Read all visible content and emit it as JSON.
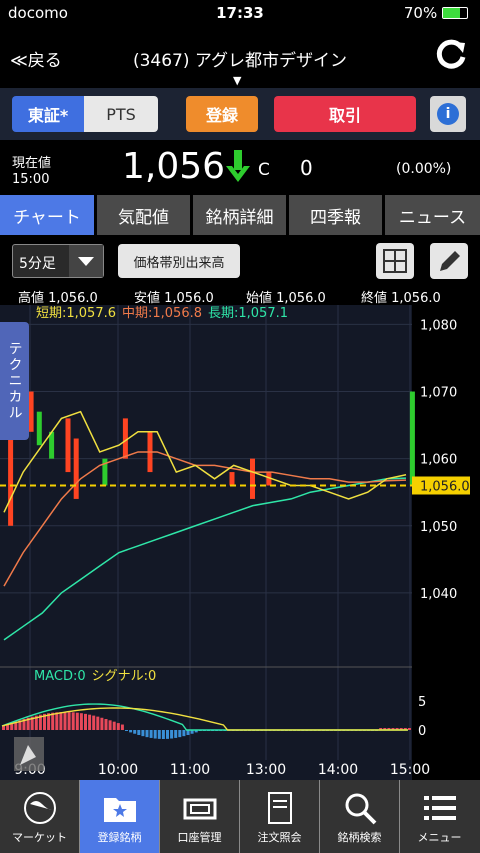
{
  "status": {
    "carrier": "docomo",
    "time": "17:33",
    "battery": "70%"
  },
  "nav": {
    "back": "≪戻る",
    "title": "(3467) アグレ都市デザイン",
    "caret": "▼"
  },
  "buttons": {
    "tse": "東証*",
    "pts": "PTS",
    "register": "登録",
    "trade": "取引",
    "info": "i"
  },
  "price": {
    "label": "現在値",
    "time": "15:00",
    "value": "1,056",
    "flag": "C",
    "change": "0",
    "pct": "(0.00%)"
  },
  "tabs": [
    "チャート",
    "気配値",
    "銘柄詳細",
    "四季報",
    "ニュース"
  ],
  "tools": {
    "interval": "5分足",
    "volume_by_price": "価格帯別出来高"
  },
  "ohlc": {
    "high": "高値 1,056.0",
    "low": "安値 1,056.0",
    "open": "始値 1,056.0",
    "close": "終値 1,056.0"
  },
  "technical_tab": "テクニカル",
  "ma_legend": {
    "short": "短期:1,057.6",
    "mid": "中期:1,056.8",
    "long": "長期:1,057.1"
  },
  "price_axis": [
    "1,080",
    "1,070",
    "1,060",
    "1,050",
    "1,040"
  ],
  "current_price_label": "1,056.0",
  "macd_legend": {
    "macd": "MACD:0",
    "signal": "シグナル:0"
  },
  "macd_axis": [
    "5",
    "0"
  ],
  "time_axis": [
    "9:00",
    "10:00",
    "11:00",
    "13:00",
    "14:00",
    "15:00"
  ],
  "colors": {
    "accent": "#4d79e6",
    "up": "#2ecc2e",
    "down": "#ff4422",
    "short_ma": "#f0e040",
    "mid_ma": "#f07a4a",
    "long_ma": "#2fe6a8",
    "price_line": "#f5d000"
  },
  "chart_data": {
    "type": "line",
    "x": [
      "9:00",
      "9:15",
      "9:30",
      "9:45",
      "10:00",
      "10:15",
      "10:30",
      "10:45",
      "11:00",
      "11:15",
      "11:30",
      "12:30",
      "12:45",
      "13:00",
      "13:15",
      "13:30",
      "13:45",
      "14:00",
      "14:15",
      "14:30",
      "14:45",
      "15:00"
    ],
    "series": [
      {
        "name": "短期",
        "values": [
          1052,
          1058,
          1062,
          1066,
          1067,
          1061,
          1062,
          1064,
          1064,
          1058,
          1059,
          1057,
          1059,
          1058,
          1057,
          1056,
          1056,
          1055,
          1054,
          1055,
          1057,
          1057.6
        ]
      },
      {
        "name": "中期",
        "values": [
          1041,
          1046,
          1050,
          1054,
          1057,
          1059,
          1060,
          1061,
          1061,
          1060,
          1059,
          1059,
          1058.5,
          1058,
          1058,
          1057.5,
          1057,
          1057,
          1056.5,
          1056.5,
          1056.7,
          1056.8
        ]
      },
      {
        "name": "長期",
        "values": [
          1033,
          1035,
          1037,
          1040,
          1042,
          1044,
          1046,
          1047,
          1048,
          1049,
          1050,
          1051,
          1052,
          1053,
          1053.5,
          1054,
          1055,
          1055.5,
          1056,
          1056.5,
          1057,
          1057.1
        ]
      }
    ],
    "ylim": [
      1030,
      1082
    ],
    "current": 1056
  }
}
